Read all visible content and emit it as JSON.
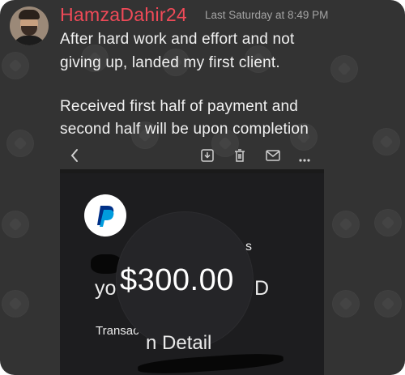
{
  "post": {
    "username": "HamzaDahir24",
    "timestamp": "Last Saturday at 8:49 PM",
    "lines": [
      "After hard work and effort and not",
      "giving up, landed my first client.",
      "",
      "Received first half of payment and",
      "second half will be upon completion"
    ]
  },
  "email_toolbar": {
    "icons": [
      "chevron-left-icon",
      "download-icon",
      "trash-icon",
      "mail-icon",
      "more-icon"
    ]
  },
  "payment_screenshot": {
    "amount": "$300.00",
    "fragment_yo": "yo",
    "fragment_d": "D",
    "fragment_transac": "Transac",
    "fragment_details": "n Detail",
    "fragment_s": "s"
  },
  "colors": {
    "background": "#333333",
    "username": "#f04a58",
    "timestamp": "#a4a4a4",
    "message": "#f1f1f1",
    "paypal_dark": "#003087",
    "paypal_light": "#009cde"
  }
}
